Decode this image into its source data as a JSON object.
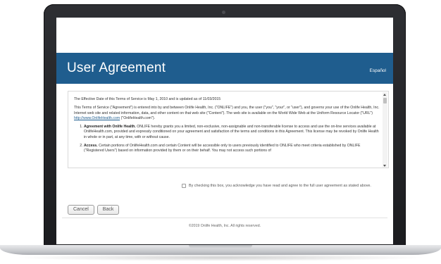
{
  "header": {
    "title": "User Agreement",
    "language_link": "Español"
  },
  "agreement": {
    "effective_date": "The Effective Date of this Terms of Service is May 1, 2010 and is updated as of 11/03/2015",
    "intro_part1": "This Terms of Service (\"Agreement\") is entered into by and between Onlife Health, Inc. (\"ONLIFE\") and you, the user (\"you\", \"your\", or \"user\"), and governs your use of the Onlife Health, Inc. Internet web site and related information, data, and other content on that web site (\"Content\"). The web site is available on the World Wide Web at the Uniform Resource Locator (\"URL\")",
    "intro_link": "http://www.OnlifeHealth.com",
    "intro_part2": "(\"OnlifeHealth.com\").",
    "sections": [
      {
        "title": "Agreement with Onlife Health.",
        "text": "ONLIFE hereby grants you a limited, non-exclusive, non-assignable and non-transferable license to access and use the on-line services available at OnlifeHealth.com, provided and expressly conditioned on your agreement and satisfaction of the terms and conditions in this Agreement. This license may be revoked by Onlife Health in whole or in part, at any time, with or without cause."
      },
      {
        "title": "Access.",
        "text": "Certain portions of OnlifeHealth.com and certain Content will be accessible only to users previously identified to ONLIFE who meet criteria established by ONLIFE (\"Registered Users\") based on information provided by them or on their behalf. You may not access such portions of"
      }
    ]
  },
  "consent": {
    "label": "By checking this box, you acknowledge you have read and agree to the full user agreement as stated above.",
    "checked": false
  },
  "buttons": {
    "cancel": "Cancel",
    "back": "Back"
  },
  "footer": {
    "copyright": "©2019 Onlife Health, Inc. All rights reserved."
  },
  "colors": {
    "header_bg": "#1f5d8e",
    "link": "#1f5d8e"
  }
}
